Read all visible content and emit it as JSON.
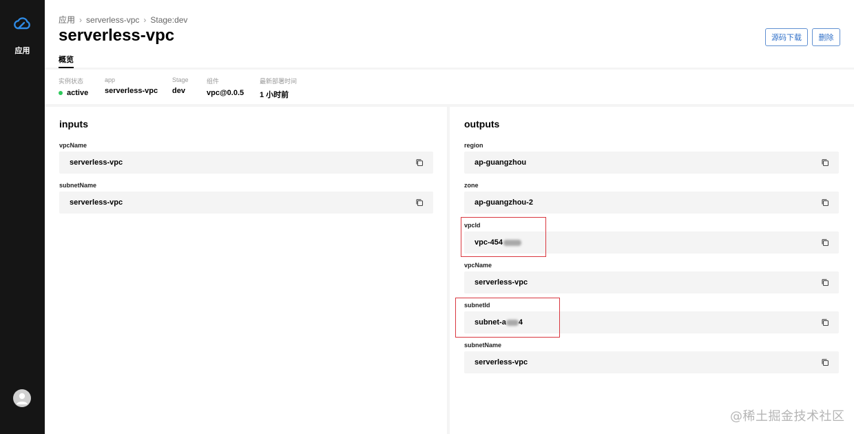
{
  "sidebar": {
    "label": "应用",
    "logo_icon": "cloud-icon",
    "avatar_icon": "user-icon"
  },
  "breadcrumb": [
    "应用",
    "serverless-vpc",
    "Stage:dev"
  ],
  "page": {
    "title": "serverless-vpc",
    "tab_overview": "概览"
  },
  "actions": {
    "download": "源码下载",
    "delete": "删除"
  },
  "info": [
    {
      "label": "实例状态",
      "value": "active"
    },
    {
      "label": "app",
      "value": "serverless-vpc"
    },
    {
      "label": "Stage",
      "value": "dev"
    },
    {
      "label": "组件",
      "value": "vpc@0.0.5"
    },
    {
      "label": "最新部署时间",
      "value": "1 小时前"
    }
  ],
  "colors": {
    "status_active": "#2ec95c",
    "accent": "#2f6fc8",
    "highlight": "#d9363e"
  },
  "inputs": {
    "title": "inputs",
    "fields": [
      {
        "label": "vpcName",
        "value": "serverless-vpc"
      },
      {
        "label": "subnetName",
        "value": "serverless-vpc"
      }
    ]
  },
  "outputs": {
    "title": "outputs",
    "fields": [
      {
        "label": "region",
        "value": "ap-guangzhou"
      },
      {
        "label": "zone",
        "value": "ap-guangzhou-2"
      },
      {
        "label": "vpcId",
        "value": "vpc-454"
      },
      {
        "label": "vpcName",
        "value": "serverless-vpc"
      },
      {
        "label": "subnetId",
        "value": "subnet-a",
        "value_tail": "4"
      },
      {
        "label": "subnetName",
        "value": "serverless-vpc"
      }
    ]
  },
  "watermark": "@稀土掘金技术社区"
}
